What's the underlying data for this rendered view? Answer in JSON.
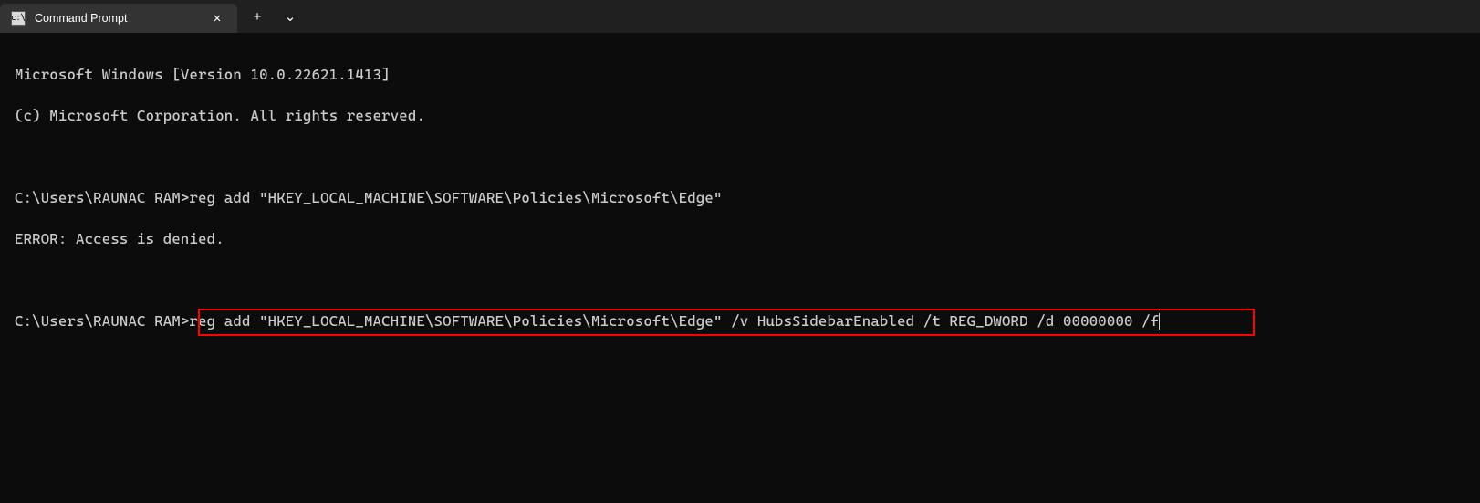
{
  "titleBar": {
    "tabTitle": "Command Prompt",
    "closeGlyph": "✕",
    "newTabGlyph": "+",
    "dropdownGlyph": "⌄"
  },
  "terminal": {
    "line1": "Microsoft Windows [Version 10.0.22621.1413]",
    "line2": "(c) Microsoft Corporation. All rights reserved.",
    "prompt1_path": "C:\\Users\\RAUNAC RAM>",
    "prompt1_cmd": "reg add \"HKEY_LOCAL_MACHINE\\SOFTWARE\\Policies\\Microsoft\\Edge\"",
    "errorLine": "ERROR: Access is denied.",
    "prompt2_path": "C:\\Users\\RAUNAC RAM>",
    "prompt2_cmd": "reg add \"HKEY_LOCAL_MACHINE\\SOFTWARE\\Policies\\Microsoft\\Edge\" /v HubsSidebarEnabled /t REG_DWORD /d 00000000 /f"
  }
}
